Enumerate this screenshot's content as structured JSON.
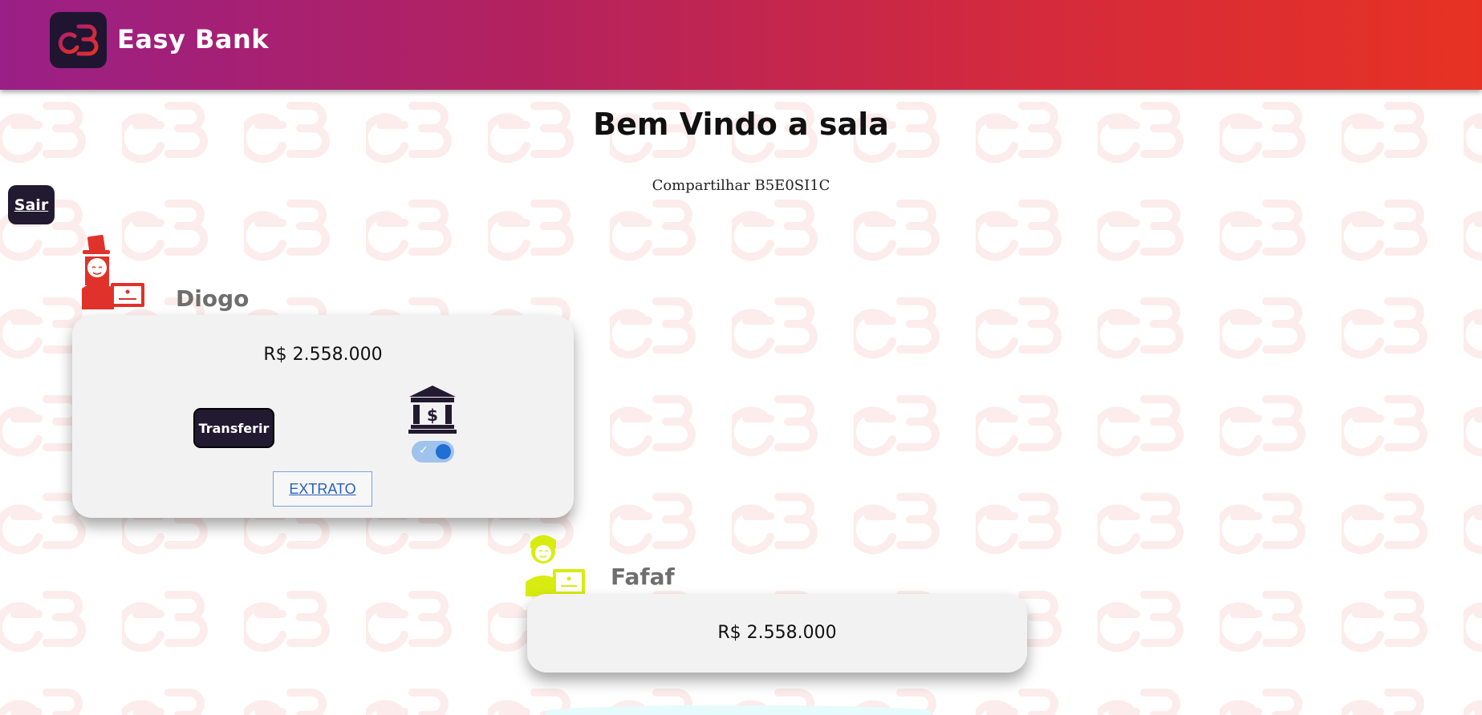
{
  "header": {
    "brand_name": "Easy Bank",
    "logo_icon": "easy-bank-logo",
    "gradient_colors": [
      "#9a1f86",
      "#e73223"
    ]
  },
  "room": {
    "title": "Bem Vindo a sala",
    "share_text": "Compartilhar B5E0SI1C"
  },
  "actions": {
    "exit_label": "Sair"
  },
  "players": [
    {
      "name": "Diogo",
      "balance": "R$ 2.558.000",
      "avatar_icon": "banker-woman-icon",
      "avatar_color": "#e0322a",
      "transfer_label": "Transferir",
      "bank_icon": "bank-icon",
      "bank_toggle_on": true,
      "statement_label": "EXTRATO"
    },
    {
      "name": "Fafaf",
      "balance": "R$ 2.558.000",
      "avatar_icon": "banker-man-icon",
      "avatar_color": "#d8ec10"
    }
  ]
}
